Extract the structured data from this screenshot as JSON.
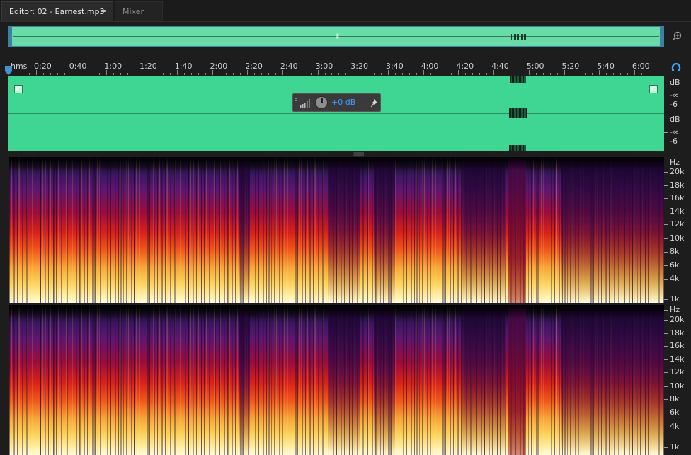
{
  "tabs": {
    "editor_label": "Editor: 02 - Earnest.mp3",
    "editor_menu_icon": "≡",
    "mixer_label": "Mixer"
  },
  "overview": {
    "center_mark": "|||",
    "icons": [
      "zoom-full-icon"
    ]
  },
  "ruler": {
    "units_label": "hms",
    "labels": [
      "0:20",
      "0:40",
      "1:00",
      "1:20",
      "1:40",
      "2:00",
      "2:20",
      "2:40",
      "3:00",
      "3:20",
      "3:40",
      "4:00",
      "4:20",
      "4:40",
      "5:00",
      "5:20",
      "5:40",
      "6:00"
    ],
    "icons": [
      "playhead-icon",
      "snap-icon"
    ]
  },
  "hud": {
    "value": "+0 dB",
    "icons": [
      "volume-bars-icon",
      "volume-knob-icon",
      "pin-icon"
    ]
  },
  "waveform": {
    "color": "#3fd693",
    "channel1_scale": [
      "dB",
      "-∞",
      "-6"
    ],
    "channel2_scale": [
      "dB",
      "-∞",
      "-6"
    ]
  },
  "spectral": {
    "channel1_scale": [
      "Hz",
      "20k",
      "18k",
      "16k",
      "14k",
      "12k",
      "10k",
      "8k",
      "6k",
      "4k",
      "1k"
    ],
    "channel2_scale": [
      "Hz",
      "20k",
      "18k",
      "16k",
      "14k",
      "12k",
      "10k",
      "8k",
      "6k",
      "4k",
      "1k"
    ]
  }
}
